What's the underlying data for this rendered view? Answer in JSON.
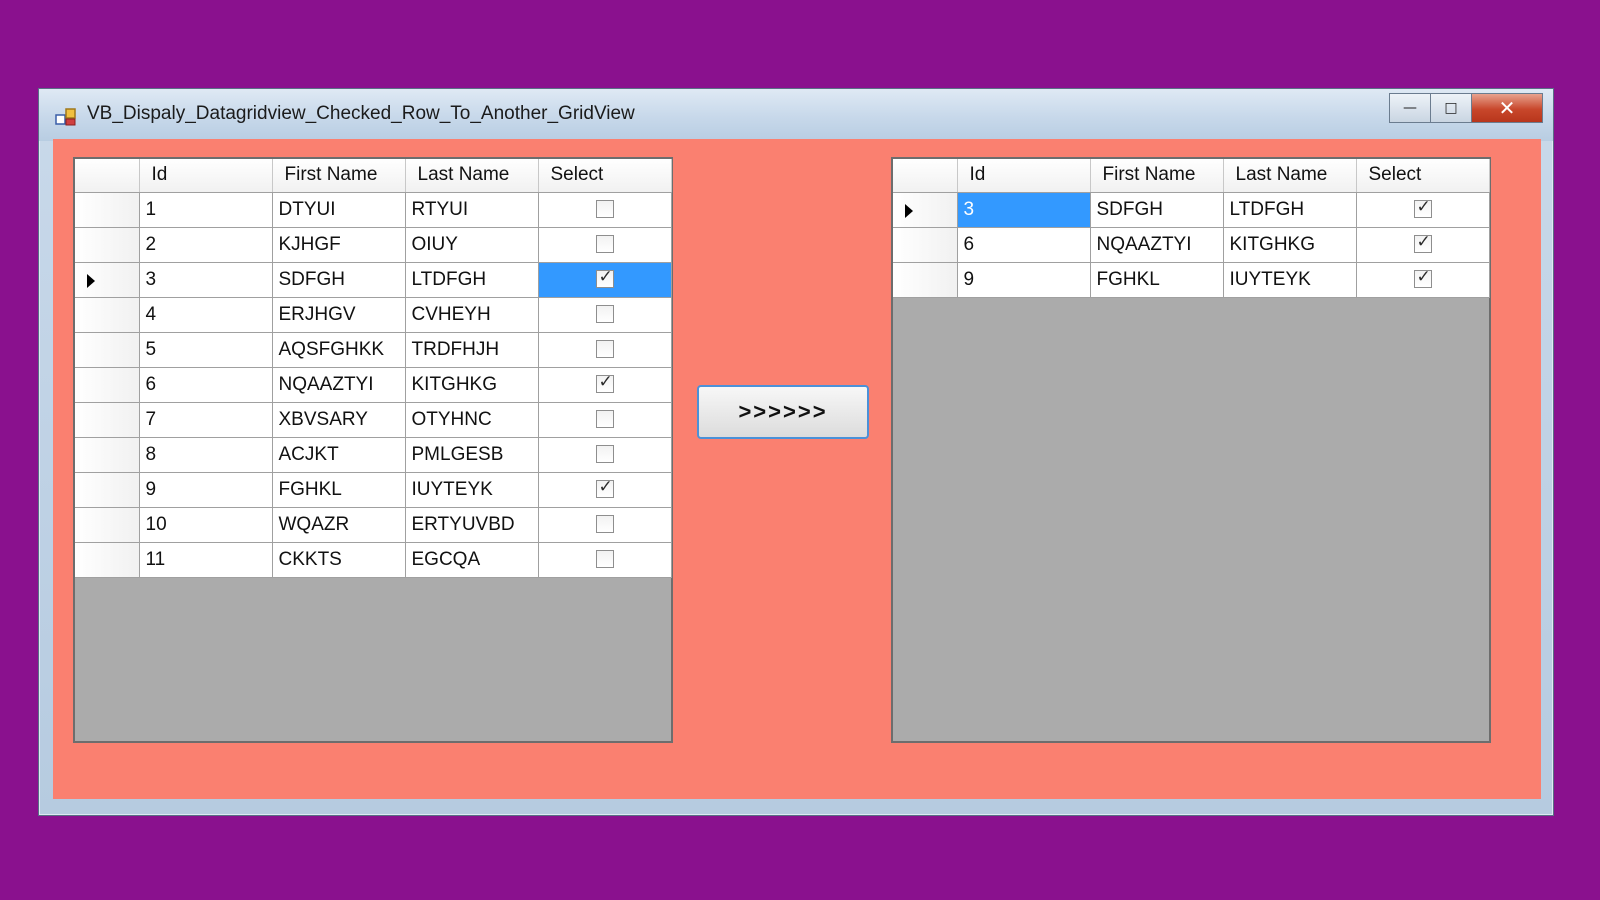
{
  "window": {
    "title": "VB_Dispaly_Datagridview_Checked_Row_To_Another_GridView",
    "minimize_glyph": "—",
    "maximize_glyph": "□",
    "close_glyph": "✕"
  },
  "move_button": {
    "label": ">>>>>>"
  },
  "source_grid": {
    "columns": [
      "Id",
      "First Name",
      "Last Name",
      "Select"
    ],
    "current_row_index": 2,
    "rows": [
      {
        "id": "1",
        "first": "DTYUI",
        "last": "RTYUI",
        "checked": false
      },
      {
        "id": "2",
        "first": "KJHGF",
        "last": "OIUY",
        "checked": false
      },
      {
        "id": "3",
        "first": "SDFGH",
        "last": "LTDFGH",
        "checked": true
      },
      {
        "id": "4",
        "first": "ERJHGV",
        "last": "CVHEYH",
        "checked": false
      },
      {
        "id": "5",
        "first": "AQSFGHKK",
        "last": "TRDFHJH",
        "checked": false
      },
      {
        "id": "6",
        "first": "NQAAZTYI",
        "last": "KITGHKG",
        "checked": true
      },
      {
        "id": "7",
        "first": "XBVSARY",
        "last": "OTYHNC",
        "checked": false
      },
      {
        "id": "8",
        "first": "ACJKT",
        "last": "PMLGESB",
        "checked": false
      },
      {
        "id": "9",
        "first": "FGHKL",
        "last": "IUYTEYK",
        "checked": true
      },
      {
        "id": "10",
        "first": "WQAZR",
        "last": "ERTYUVBD",
        "checked": false
      },
      {
        "id": "11",
        "first": "CKKTS",
        "last": "EGCQA",
        "checked": false
      }
    ]
  },
  "target_grid": {
    "columns": [
      "Id",
      "First Name",
      "Last Name",
      "Select"
    ],
    "current_row_index": 0,
    "rows": [
      {
        "id": "3",
        "first": "SDFGH",
        "last": "LTDFGH",
        "checked": true
      },
      {
        "id": "6",
        "first": "NQAAZTYI",
        "last": "KITGHKG",
        "checked": true
      },
      {
        "id": "9",
        "first": "FGHKL",
        "last": "IUYTEYK",
        "checked": true
      }
    ]
  },
  "colors": {
    "desktop_background": "#8a118e",
    "form_background": "#fa8070",
    "grid_empty_area": "#ababab",
    "selection_highlight": "#3399ff"
  }
}
